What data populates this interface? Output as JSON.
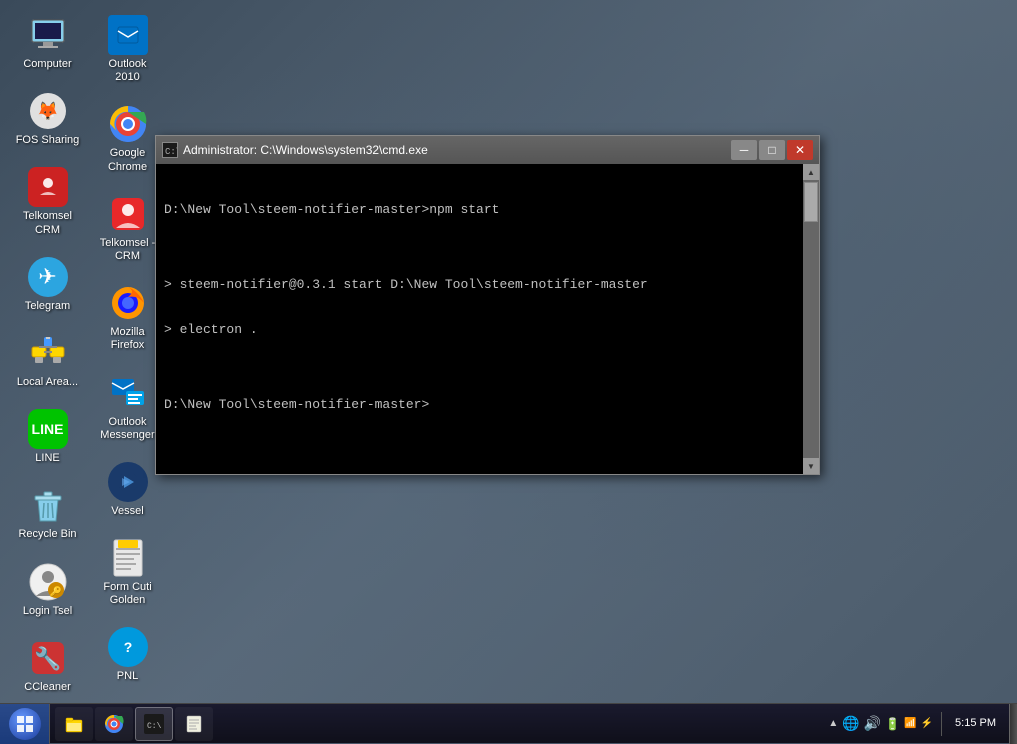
{
  "desktop": {
    "background": "#4a5a6a"
  },
  "icons": [
    {
      "id": "computer",
      "label": "Computer",
      "emoji": "🖥️",
      "style": "plain"
    },
    {
      "id": "fos-sharing",
      "label": "FOS Sharing",
      "emoji": "🦊",
      "style": "plain"
    },
    {
      "id": "telkomsel-crm-top",
      "label": "Telkomsel CRM",
      "emoji": "📱",
      "style": "red-round"
    },
    {
      "id": "telegram",
      "label": "Telegram",
      "emoji": "✈",
      "style": "blue-round"
    },
    {
      "id": "local-area",
      "label": "Local Area...",
      "emoji": "🖧",
      "style": "plain"
    },
    {
      "id": "line",
      "label": "LINE",
      "text": "LINE",
      "style": "green-round"
    },
    {
      "id": "recycle-bin",
      "label": "Recycle Bin",
      "emoji": "🗑️",
      "style": "plain"
    },
    {
      "id": "login-tsel",
      "label": "Login Tsel",
      "emoji": "👤",
      "style": "plain"
    },
    {
      "id": "ccleaner",
      "label": "CCleaner",
      "emoji": "🔧",
      "style": "red-round"
    },
    {
      "id": "outlook2010",
      "label": "Outlook 2010",
      "emoji": "📧",
      "style": "blue-sq"
    },
    {
      "id": "google-chrome",
      "label": "Google Chrome",
      "emoji": "⊙",
      "style": "chrome"
    },
    {
      "id": "telkomsel-crm",
      "label": "Telkomsel - CRM",
      "emoji": "📱",
      "style": "red-round"
    },
    {
      "id": "mozilla-firefox",
      "label": "Mozilla Firefox",
      "emoji": "🦊",
      "style": "plain"
    },
    {
      "id": "outlook-messenger",
      "label": "Outlook Messenger",
      "emoji": "📧",
      "style": "blue-sq"
    },
    {
      "id": "vessel",
      "label": "Vessel",
      "emoji": "⚡",
      "style": "darkblue-round"
    },
    {
      "id": "form-cuti",
      "label": "Form Cuti Golden",
      "emoji": "📋",
      "style": "plain"
    },
    {
      "id": "pnl",
      "label": "PNL",
      "emoji": "❓",
      "style": "lightblue-round"
    }
  ],
  "cmd_window": {
    "title": "Administrator: C:\\Windows\\system32\\cmd.exe",
    "lines": [
      "D:\\New Tool\\steem-notifier-master>npm start",
      "",
      "> steem-notifier@0.3.1 start D:\\New Tool\\steem-notifier-master",
      "> electron .",
      "",
      "D:\\New Tool\\steem-notifier-master>"
    ]
  },
  "taskbar": {
    "start_label": "⊞",
    "items": [
      {
        "id": "explorer",
        "emoji": "📁"
      },
      {
        "id": "chrome-taskbar",
        "emoji": "⊙"
      },
      {
        "id": "cmd-taskbar",
        "emoji": "⬛"
      },
      {
        "id": "notepad-taskbar",
        "emoji": "📝"
      }
    ],
    "clock": {
      "time": "5:15 PM",
      "date": ""
    },
    "tray": {
      "icons": [
        "▲",
        "🔇",
        "📶",
        "🔋"
      ]
    }
  }
}
